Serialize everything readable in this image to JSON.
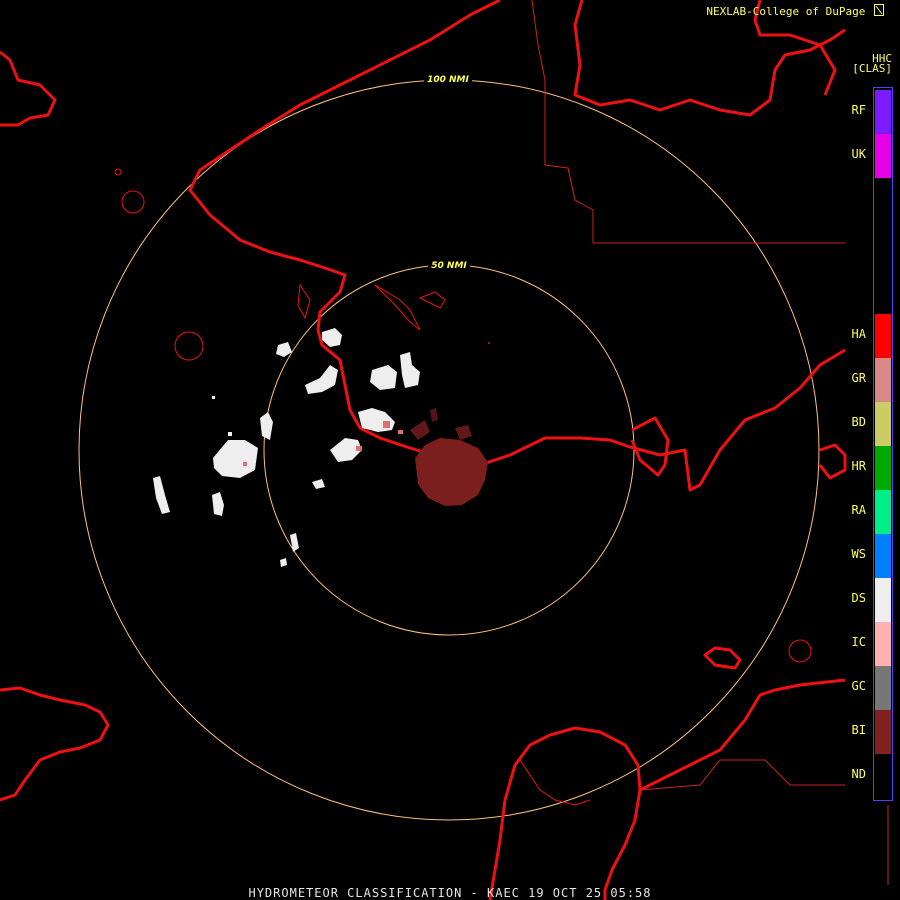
{
  "credit": "NEXLAB-College of DuPage",
  "credit_icon": "arrow-icon",
  "legend": {
    "product_code": "HHC",
    "product_type": "[CLAS]",
    "classes": [
      {
        "code": "RF",
        "color": "#7a1cff"
      },
      {
        "code": "UK",
        "color": "#e600e6"
      },
      {
        "code": "HA",
        "color": "#ff0000"
      },
      {
        "code": "GR",
        "color": "#d98888"
      },
      {
        "code": "BD",
        "color": "#cccc66"
      },
      {
        "code": "HR",
        "color": "#00aa00"
      },
      {
        "code": "RA",
        "color": "#00ee88"
      },
      {
        "code": "WS",
        "color": "#0080ff"
      },
      {
        "code": "DS",
        "color": "#eeeeee"
      },
      {
        "code": "IC",
        "color": "#ffb0b0"
      },
      {
        "code": "GC",
        "color": "#777777"
      },
      {
        "code": "BI",
        "color": "#802020"
      },
      {
        "code": "ND",
        "color": "#000000"
      }
    ]
  },
  "rings": {
    "inner_label": "50 NMI",
    "outer_label": "100 NMI",
    "color": "#ffc080"
  },
  "map_colors": {
    "coastline": "#ee1111",
    "boundary": "#cc2222"
  },
  "footer": "HYDROMETEOR CLASSIFICATION - KAEC 19 OCT 25 05:58"
}
